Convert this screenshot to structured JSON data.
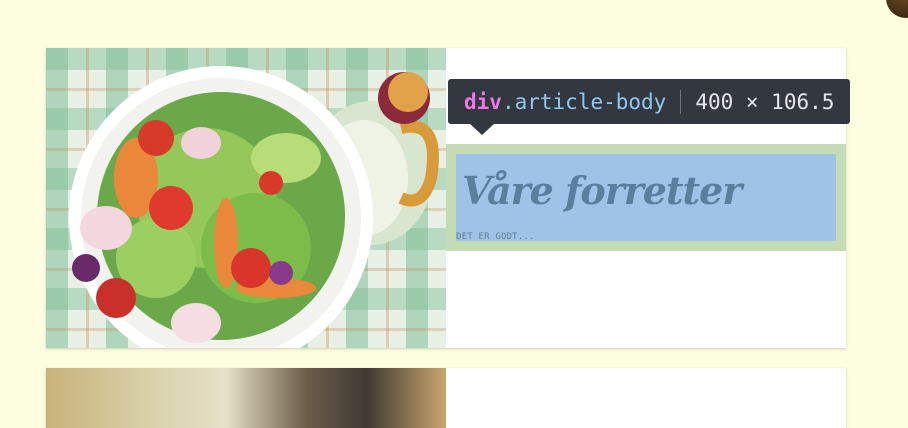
{
  "article": {
    "title": "Våre forretter",
    "subtitle": "DET ER GODT..."
  },
  "inspector_tooltip": {
    "tag": "div",
    "dot": ".",
    "class_name": "article-body",
    "dimensions": "400 × 106.5"
  },
  "colors": {
    "page_background": "#fdfde0",
    "content_highlight": "#9fc3e6",
    "padding_highlight": "#c5dbb6",
    "tooltip_background": "#333740"
  },
  "images": {
    "card1": "salad-bowl-photo",
    "card2": "food-photo-partial"
  }
}
